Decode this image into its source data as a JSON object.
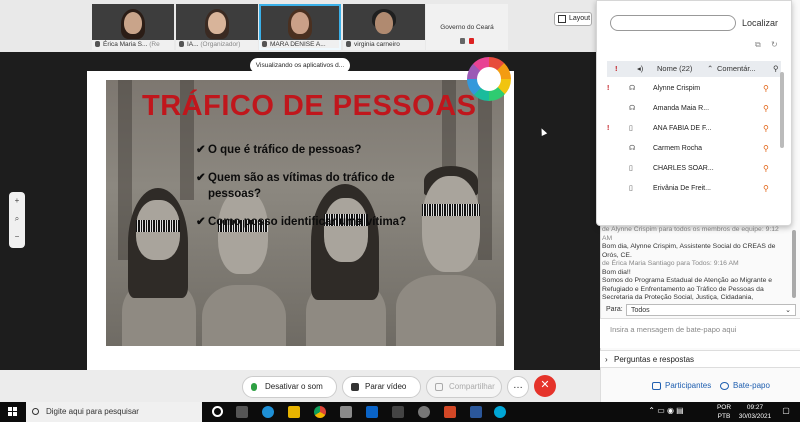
{
  "thumbnails": [
    {
      "name": "Érica Maria S...",
      "role": "(Re"
    },
    {
      "name": "IA...",
      "role": "(Organizador)"
    },
    {
      "name": "MARA DENISE A...",
      "role": ""
    },
    {
      "name": "virginia carneiro",
      "role": ""
    },
    {
      "name": "Governo do Ceará",
      "role": ""
    }
  ],
  "layout_button": "Layout",
  "share_banner": "Visualizando os aplicativos d...",
  "slide": {
    "title": "TRÁFICO DE PESSOAS",
    "bullets": [
      "O que é tráfico de pessoas?",
      "Quem são as vítimas do tráfico de pessoas?",
      "Como posso identificar uma vítima?"
    ]
  },
  "zoom": [
    "+",
    "⌕",
    "−"
  ],
  "controls": {
    "mute": "Desativar o som",
    "video": "Parar vídeo",
    "share": "Compartilhar",
    "more": "…",
    "end": "✕",
    "participants": "Participantes",
    "chat": "Bate-papo"
  },
  "participants_panel": {
    "search_placeholder": "",
    "find_button": "Localizar",
    "header_name": "Nome (22)",
    "header_comment": "Comentár...",
    "rows": [
      {
        "flag": "!",
        "name": "Alynne Crispim"
      },
      {
        "flag": "",
        "name": "Amanda Maia R..."
      },
      {
        "flag": "!",
        "name": "ANA FABIA DE F..."
      },
      {
        "flag": "",
        "name": "Carmem Rocha"
      },
      {
        "flag": "",
        "name": "CHARLES SOAR..."
      },
      {
        "flag": "",
        "name": "Erivânia De Freit..."
      }
    ]
  },
  "chat": {
    "messages": [
      {
        "from": "de Alynne Crispim para todos os membros de equipe:",
        "time": "9:12 AM",
        "text": "Bom dia, Alynne Crispim, Assistente Social do CREAS de Orós, CE."
      },
      {
        "from": "de Érica Maria Santiago para Todos:",
        "time": "9:16 AM",
        "text": "Bom dia!!"
      },
      {
        "from": "",
        "time": "",
        "text": "Somos do Programa Estadual de Atenção ao Migrante e Refugiado e Enfrentamento ao Tráfico de Pessoas da Secretaria da Proteção Social, Justiça, Cidadania,"
      }
    ],
    "to_label": "Para:",
    "to_value": "Todos",
    "input_placeholder": "Insira a mensagem de bate-papo aqui",
    "qa_label": "Perguntas e respostas"
  },
  "taskbar": {
    "search_placeholder": "Digite aqui para pesquisar",
    "lang": "POR",
    "layout": "PTB",
    "time": "09:27",
    "date": "30/03/2021"
  }
}
